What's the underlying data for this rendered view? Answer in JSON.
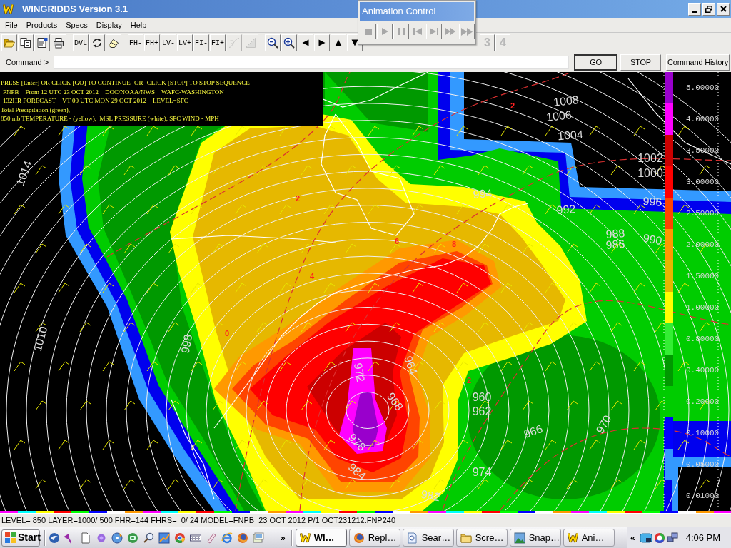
{
  "window": {
    "title": "WINGRIDDS Version 3.1"
  },
  "menu": [
    "File",
    "Products",
    "Specs",
    "Display",
    "Help"
  ],
  "toolbar": {
    "items": [
      {
        "kind": "icon",
        "disabled": false
      },
      {
        "kind": "icon",
        "disabled": false
      },
      {
        "kind": "icon",
        "disabled": false
      },
      {
        "kind": "icon",
        "disabled": false
      },
      {
        "kind": "separator"
      },
      {
        "kind": "text",
        "label": "DVL",
        "disabled": false
      },
      {
        "kind": "icon",
        "disabled": false
      },
      {
        "kind": "icon",
        "disabled": false
      },
      {
        "kind": "separator"
      },
      {
        "kind": "text",
        "label": "FH-",
        "disabled": false
      },
      {
        "kind": "text",
        "label": "FH+",
        "disabled": false
      },
      {
        "kind": "text",
        "label": "LV-",
        "disabled": false
      },
      {
        "kind": "text",
        "label": "LV+",
        "disabled": false
      },
      {
        "kind": "text",
        "label": "FI-",
        "disabled": false
      },
      {
        "kind": "text",
        "label": "FI+",
        "disabled": false
      },
      {
        "kind": "icon",
        "disabled": true
      },
      {
        "kind": "icon",
        "disabled": true
      },
      {
        "kind": "separator"
      },
      {
        "kind": "icon",
        "disabled": false
      },
      {
        "kind": "icon",
        "disabled": false
      },
      {
        "kind": "icon",
        "disabled": false
      },
      {
        "kind": "icon",
        "disabled": false
      },
      {
        "kind": "icon",
        "disabled": false
      },
      {
        "kind": "icon",
        "disabled": false
      }
    ],
    "page_buttons": [
      {
        "label": "3",
        "disabled": true
      },
      {
        "label": "4",
        "disabled": true
      }
    ]
  },
  "command": {
    "label": "Command >",
    "buttons": [
      {
        "label": "GO",
        "focused": true
      },
      {
        "label": "STOP",
        "focused": false
      },
      {
        "label": "Command History",
        "focused": false
      }
    ]
  },
  "map": {
    "info_lines": [
      "PRESS [Enter] OR CLICK [GO] TO CONTINUE -OR- CLICK [STOP] TO STOP SEQUENCE",
      "FNPB    From 12 UTC 23 OCT 2012    DOC/NOAA/NWS    WAFC-WASHINGTON",
      "132HR FORECAST    VT 00 UTC MON 29 OCT 2012    LEVEL=SFC",
      "Total Precipitation (green),",
      "850 mb TEMPERATURE - (yellow),  MSL PRESSURE (white), SFC WIND - MPH"
    ],
    "legend": {
      "items": [
        {
          "value": "5.00000",
          "color": "#9900cc"
        },
        {
          "value": "4.00000",
          "color": "#ff00ff"
        },
        {
          "value": "3.50000",
          "color": "#cc0000"
        },
        {
          "value": "3.00000",
          "color": "#ff0000"
        },
        {
          "value": "2.50000",
          "color": "#ff4400"
        },
        {
          "value": "2.00000",
          "color": "#ff9900"
        },
        {
          "value": "1.50000",
          "color": "#e6b800"
        },
        {
          "value": "1.00000",
          "color": "#ffff00"
        },
        {
          "value": "0.80000",
          "color": "#33ee33"
        },
        {
          "value": "0.40000",
          "color": "#009900"
        },
        {
          "value": "0.20000",
          "color": "#00cc00"
        },
        {
          "value": "0.10000",
          "color": "#0000ff"
        },
        {
          "value": "0.05000",
          "color": "#3399ff"
        },
        {
          "value": "0.01000"
        }
      ]
    },
    "isobar_labels": [
      "1008",
      "1006",
      "1004",
      "1002",
      "1000",
      "1014",
      "994",
      "996",
      "992",
      "988",
      "986",
      "990",
      "998",
      "1010",
      "972",
      "964",
      "968",
      "960",
      "962",
      "970",
      "966",
      "978",
      "974",
      "984",
      "982"
    ],
    "temperature_labels": [
      "2",
      "2",
      "4",
      "6",
      "8",
      "0",
      "2"
    ]
  },
  "status_bar": "LEVEL= 850 LAYER=1000/ 500 FHR=144 FHRS=  0/ 24 MODEL=FNPB  23 OCT 2012 P/1 OCT231212.FNP240",
  "taskbar": {
    "start": "Start",
    "overflow": "»",
    "tasks": [
      {
        "label": "WI…",
        "selected": true
      },
      {
        "label": "Repl…",
        "selected": false
      },
      {
        "label": "Sear…",
        "selected": false
      },
      {
        "label": "Scre…",
        "selected": false
      },
      {
        "label": "Snap…",
        "selected": false
      },
      {
        "label": "Ani…",
        "selected": false
      }
    ],
    "tray_toggle": "«",
    "clock": "4:06 PM"
  },
  "animation_control": {
    "title": "Animation Control",
    "buttons": [
      {
        "disabled": true
      },
      {
        "disabled": true
      },
      {
        "disabled": true
      },
      {
        "disabled": true
      },
      {
        "disabled": true
      },
      {
        "disabled": true
      },
      {
        "disabled": true
      }
    ]
  }
}
